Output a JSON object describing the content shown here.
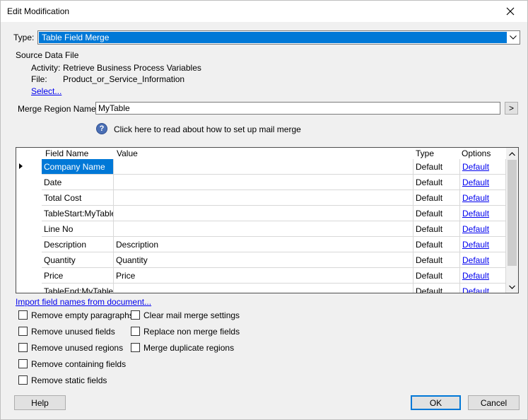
{
  "window": {
    "title": "Edit Modification"
  },
  "type_field": {
    "label": "Type:",
    "value": "Table Field Merge"
  },
  "source": {
    "heading": "Source Data File",
    "activity_label": "Activity:",
    "activity_value": "Retrieve Business Process Variables",
    "file_label": "File:",
    "file_value": "Product_or_Service_Information",
    "select_link": "Select..."
  },
  "merge_region": {
    "label": "Merge Region Name:",
    "value": "MyTable",
    "browse_label": ">"
  },
  "help_link": {
    "icon_glyph": "?",
    "text": "Click here to read about how to set up mail merge"
  },
  "grid": {
    "columns": {
      "name": "Field Name",
      "value": "Value",
      "type": "Type",
      "options": "Options"
    },
    "rows": [
      {
        "name": "Company Name",
        "value": "",
        "type": "Default",
        "options": "Default"
      },
      {
        "name": "Date",
        "value": "",
        "type": "Default",
        "options": "Default"
      },
      {
        "name": "Total Cost",
        "value": "",
        "type": "Default",
        "options": "Default"
      },
      {
        "name": "TableStart:MyTable",
        "value": "",
        "type": "Default",
        "options": "Default"
      },
      {
        "name": "Line No",
        "value": "",
        "type": "Default",
        "options": "Default"
      },
      {
        "name": "Description",
        "value": "Description",
        "type": "Default",
        "options": "Default"
      },
      {
        "name": "Quantity",
        "value": "Quantity",
        "type": "Default",
        "options": "Default"
      },
      {
        "name": "Price",
        "value": "Price",
        "type": "Default",
        "options": "Default"
      },
      {
        "name": "TableEnd:MyTable",
        "value": "",
        "type": "Default",
        "options": "Default"
      }
    ]
  },
  "import_link": "Import field names from document...",
  "checkboxes": {
    "remove_empty_paragraphs": "Remove empty paragraphs",
    "remove_unused_fields": "Remove unused fields",
    "remove_unused_regions": "Remove unused regions",
    "remove_containing_fields": "Remove containing fields",
    "remove_static_fields": "Remove static fields",
    "clear_mail_merge_settings": "Clear mail merge settings",
    "replace_non_merge_fields": "Replace non merge fields",
    "merge_duplicate_regions": "Merge duplicate regions"
  },
  "buttons": {
    "help": "Help",
    "ok": "OK",
    "cancel": "Cancel"
  }
}
